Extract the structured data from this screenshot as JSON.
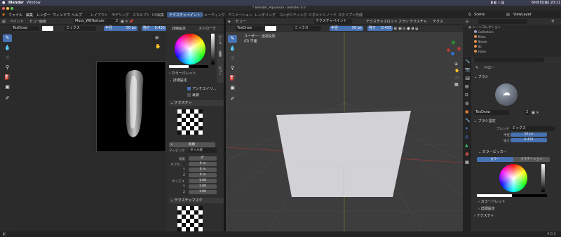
{
  "mac": {
    "app": "Blender",
    "menu": "Window",
    "status_right": "6月6日(金)  20:11"
  },
  "window_title": "* Blender_Aquarium - Blender 4.0",
  "topbar": {
    "menus": [
      "ファイル",
      "編集",
      "レンダー",
      "ウィンドウ",
      "ヘルプ"
    ],
    "workspaces": [
      "レイアウト",
      "モデリング",
      "スカルプト",
      "UV編集",
      "テクスチャペイント",
      "シェーディング",
      "アニメーション",
      "レンダリング",
      "コンポジティング",
      "ジオメトリノード",
      "スクリプト作成"
    ],
    "active_workspace": "テクスチャペイント",
    "scene": "Scene",
    "view_layer": "ViewLayer"
  },
  "image_editor": {
    "header": {
      "mode": "ペイント",
      "menus": [
        "ビュー",
        "画像"
      ],
      "image_name": "Moss_WBTexture",
      "image_users": "2"
    },
    "brush_bar": {
      "brush": "TexDraw",
      "blend": "ミックス",
      "radius_label": "半径",
      "radius": "50 px",
      "strength_label": "強さ",
      "strength": "0.433",
      "advanced": "詳細設定",
      "stroke": "ストローク"
    }
  },
  "sidebar_left": {
    "tabs": [
      "ツール",
      "画像",
      "ビュー"
    ],
    "color_palette": "カラーパレット",
    "advanced": "詳細設定",
    "antialias": "アンチエイリ...",
    "mask": "裏側",
    "texture_title": "テクスチャ",
    "new_button": "新規",
    "mapping_label": "マッピング",
    "mapping_value": "タイル状",
    "angle_label": "角度",
    "angle_value": "0°",
    "offset_label": "オフセ...",
    "offset_x": "0 m",
    "offset_y_label": "Y",
    "offset_y": "0 m",
    "offset_z_label": "Z",
    "offset_z": "0 m",
    "size_label": "サイズ X",
    "size_x": "1.00",
    "size_y_label": "Y",
    "size_y": "1.00",
    "size_z_label": "Z",
    "size_z": "1.00",
    "texture_mask_title": "テクスチャマスク"
  },
  "viewport": {
    "brush": "TexDraw",
    "blend": "ミックス",
    "radius_label": "半径",
    "radius": "50 px",
    "strength_label": "強さ",
    "strength": "0.433",
    "menus": [
      "ビュー"
    ],
    "mode": "テクスチャペイント",
    "slots": "テクスチャスロット...",
    "brush_menu": "ブラシ",
    "texture_menu": "テクスチャ",
    "texture_menu_2": "テクス",
    "overlay_line1": "ユーザー・透視投影",
    "overlay_line2": "(0) 平面"
  },
  "outliner": {
    "title": "シーンコレクション",
    "items": [
      {
        "name": "Collection",
        "color": "#9aa2c0"
      },
      {
        "name": "Moss",
        "color": "#e08c4a"
      },
      {
        "name": "Stone",
        "color": "#e08c4a"
      },
      {
        "name": "Iki",
        "color": "#e08c4a"
      },
      {
        "name": "Hane",
        "color": "#e08c4a"
      }
    ]
  },
  "properties": {
    "brush_mode": "ドロー",
    "brush_section": "ブラシ",
    "brush_name": "TexDraw",
    "brush_users": "2",
    "brush_settings": "ブラシ設定",
    "blend_label": "ブレンド",
    "blend_value": "ミックス",
    "radius_label": "半径",
    "radius_value": "50 px",
    "strength_label": "強さ",
    "strength_value": "0.433",
    "color_picker": "カラーピッカー",
    "tab_color": "カラー",
    "tab_gradient": "グラデーション",
    "palette": "カラーパレット",
    "advanced": "詳細設定",
    "texture": "テクスチャ"
  },
  "status": {
    "version": "4.0.2"
  },
  "colors": {
    "accent": "#4772b3",
    "ui_bg": "#2a2a2a",
    "viewport_bg": "#3d3d3d",
    "plane": "#d2d2d6"
  }
}
